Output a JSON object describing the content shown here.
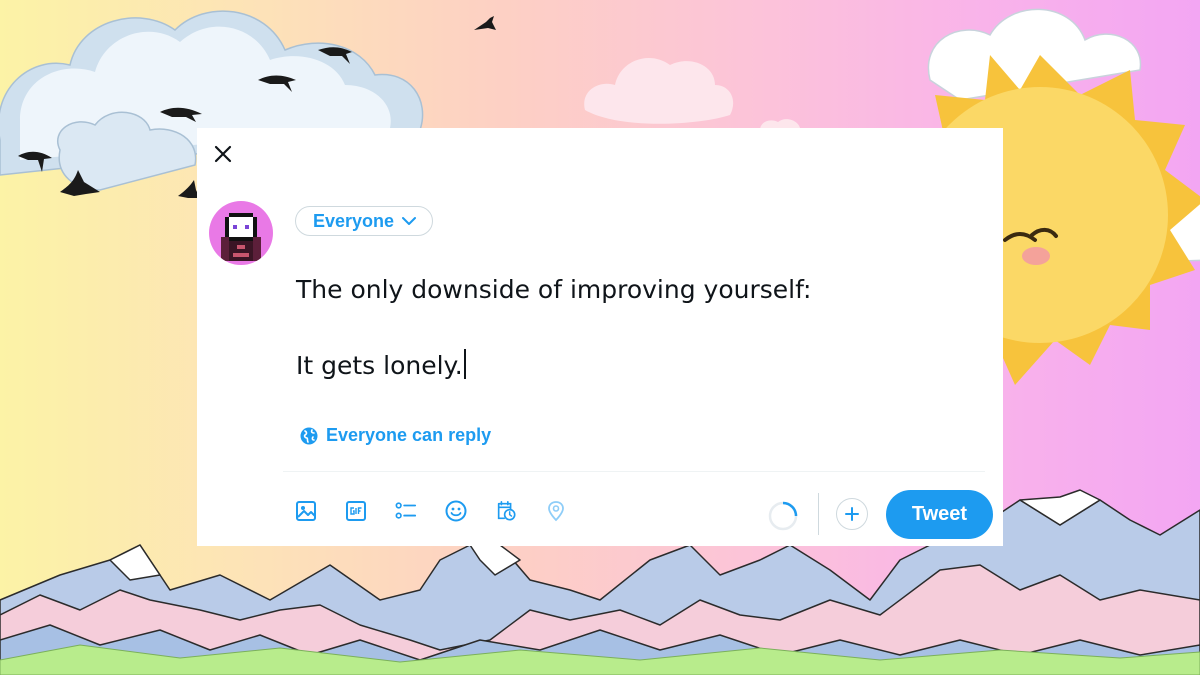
{
  "dialog": {
    "close_icon": "close-icon",
    "avatar_alt": "pixel-art avatar",
    "audience": {
      "label": "Everyone",
      "icon": "chevron-down-icon"
    },
    "compose": {
      "lines": [
        "The only downside of improving yourself:",
        "",
        "It gets lonely."
      ]
    },
    "reply_setting": {
      "label": "Everyone can reply",
      "icon": "globe-icon"
    },
    "toolbar": {
      "items": [
        "media-icon",
        "gif-icon",
        "poll-icon",
        "emoji-icon",
        "schedule-icon",
        "location-icon"
      ]
    },
    "add_icon": "plus-icon",
    "tweet_label": "Tweet"
  },
  "colors": {
    "accent": "#1d9bf0",
    "text": "#0f1419",
    "border": "#cfd9de",
    "avatar_bg": "#e979e6"
  }
}
